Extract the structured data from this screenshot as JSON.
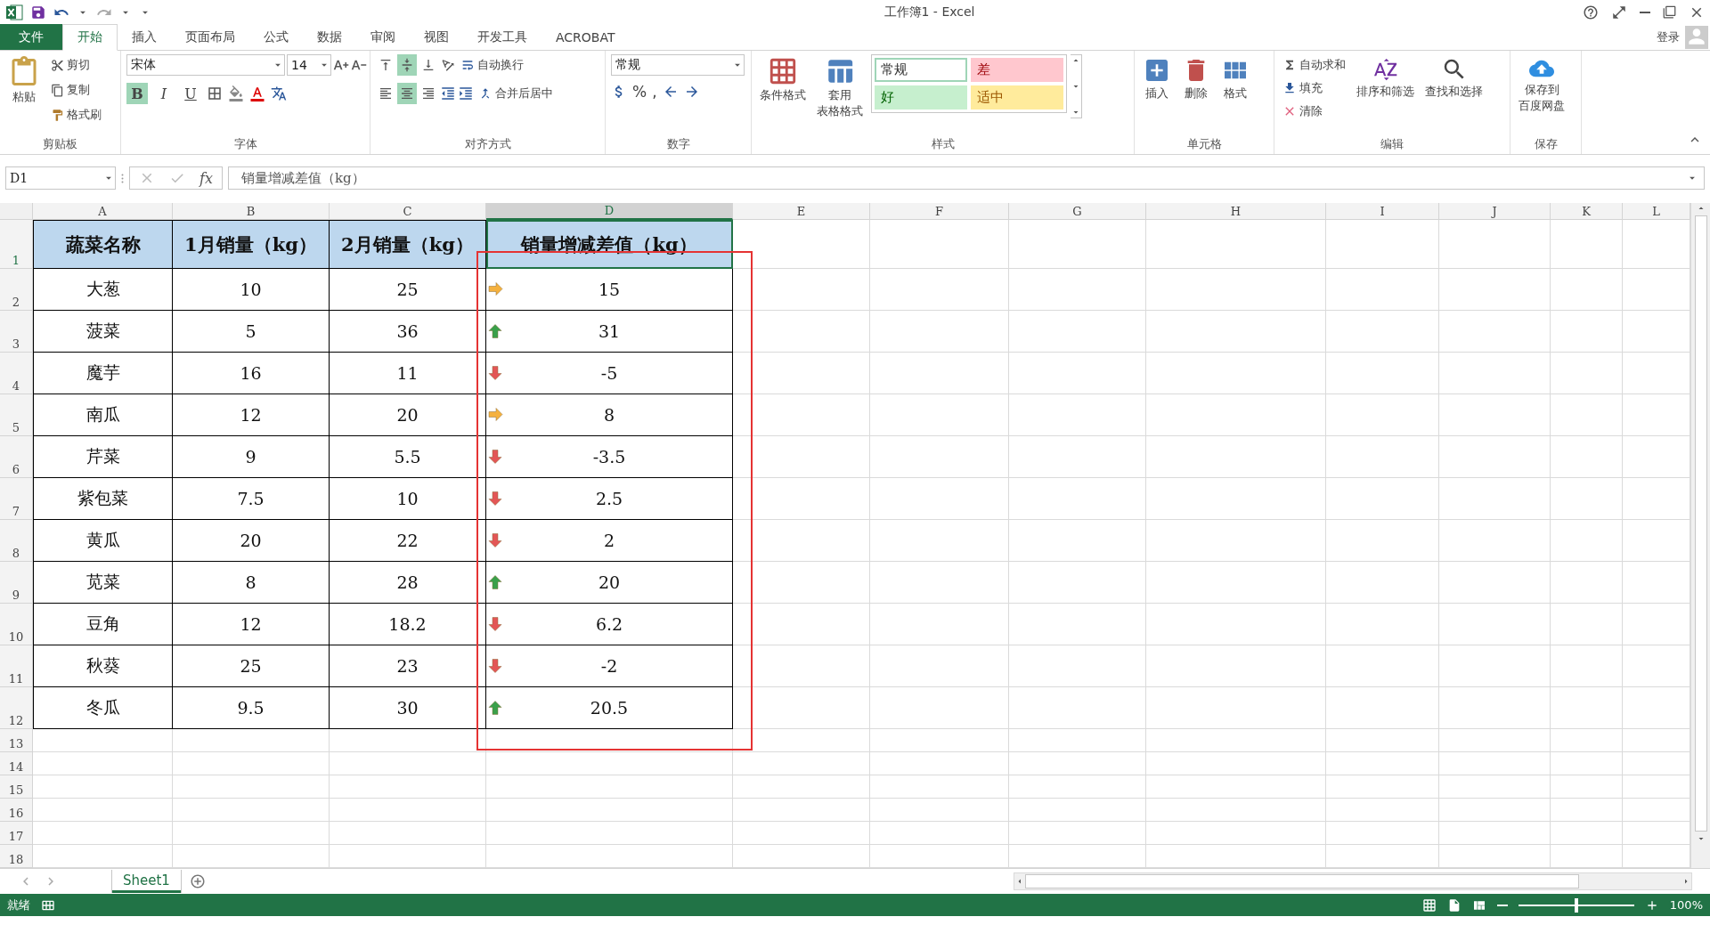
{
  "window": {
    "title": "工作簿1 - Excel",
    "user": "登录"
  },
  "menu_tabs": [
    {
      "label": "文件",
      "kind": "file",
      "selected": false
    },
    {
      "label": "开始",
      "kind": "tab",
      "selected": true
    },
    {
      "label": "插入",
      "kind": "tab",
      "selected": false
    },
    {
      "label": "页面布局",
      "kind": "tab",
      "selected": false
    },
    {
      "label": "公式",
      "kind": "tab",
      "selected": false
    },
    {
      "label": "数据",
      "kind": "tab",
      "selected": false
    },
    {
      "label": "审阅",
      "kind": "tab",
      "selected": false
    },
    {
      "label": "视图",
      "kind": "tab",
      "selected": false
    },
    {
      "label": "开发工具",
      "kind": "tab",
      "selected": false
    },
    {
      "label": "ACROBAT",
      "kind": "tab",
      "selected": false
    }
  ],
  "ribbon": {
    "clipboard": {
      "label": "剪贴板",
      "paste": "粘贴",
      "cut": "剪切",
      "copy": "复制",
      "painter": "格式刷"
    },
    "font": {
      "label": "字体",
      "name": "宋体",
      "size": "14",
      "bold": {
        "label": "B",
        "on": true
      },
      "italic": {
        "label": "I",
        "on": false
      },
      "underline": {
        "label": "U",
        "on": false
      }
    },
    "alignment": {
      "label": "对齐方式",
      "top": false,
      "middle": true,
      "bottom": false,
      "left": false,
      "center": true,
      "right": false,
      "wrap": "自动换行",
      "merge": "合并后居中"
    },
    "number": {
      "label": "数字",
      "format": "常规",
      "percent": "%",
      "comma": ","
    },
    "styles": {
      "label": "样式",
      "conditional": "条件格式",
      "table": [
        "套用",
        "表格格式"
      ],
      "cell_styles": [
        {
          "label": "常规",
          "color": "#ffffff",
          "selected": true
        },
        {
          "label": "差",
          "color": "#ffc7ce",
          "selected": false
        },
        {
          "label": "好",
          "color": "#c6efce",
          "selected": false
        },
        {
          "label": "适中",
          "color": "#ffeb9c",
          "selected": false
        }
      ]
    },
    "cells": {
      "label": "单元格",
      "insert": "插入",
      "delete": "删除",
      "format": "格式"
    },
    "editing": {
      "label": "编辑",
      "autosum": "自动求和",
      "fill": "填充",
      "clear": "清除",
      "sort": "排序和筛选",
      "find": "查找和选择"
    },
    "save": {
      "label": "保存",
      "button": [
        "保存到",
        "百度网盘"
      ]
    }
  },
  "formula_bar": {
    "name_box": "D1",
    "fx": "fx",
    "content": "销量增减差值（kg）"
  },
  "sheet": {
    "columns": [
      {
        "label": "A",
        "selected": false
      },
      {
        "label": "B",
        "selected": false
      },
      {
        "label": "C",
        "selected": false
      },
      {
        "label": "D",
        "selected": true
      },
      {
        "label": "E",
        "selected": false
      },
      {
        "label": "F",
        "selected": false
      },
      {
        "label": "G",
        "selected": false
      },
      {
        "label": "H",
        "selected": false
      },
      {
        "label": "I",
        "selected": false
      },
      {
        "label": "J",
        "selected": false
      },
      {
        "label": "K",
        "selected": false
      },
      {
        "label": "L",
        "selected": false
      }
    ],
    "row_numbers": [
      "1",
      "2",
      "3",
      "4",
      "5",
      "6",
      "7",
      "8",
      "9",
      "10",
      "11",
      "12",
      "13",
      "14",
      "15",
      "16",
      "17",
      "18"
    ],
    "header": [
      "蔬菜名称",
      "1月销量（kg）",
      "2月销量（kg）",
      "销量增减差值（kg）"
    ],
    "rows": [
      {
        "name": "大葱",
        "jan": "10",
        "feb": "25",
        "diff": "15",
        "kind": "flat"
      },
      {
        "name": "菠菜",
        "jan": "5",
        "feb": "36",
        "diff": "31",
        "kind": "up"
      },
      {
        "name": "魔芋",
        "jan": "16",
        "feb": "11",
        "diff": "-5",
        "kind": "down"
      },
      {
        "name": "南瓜",
        "jan": "12",
        "feb": "20",
        "diff": "8",
        "kind": "flat"
      },
      {
        "name": "芹菜",
        "jan": "9",
        "feb": "5.5",
        "diff": "-3.5",
        "kind": "down"
      },
      {
        "name": "紫包菜",
        "jan": "7.5",
        "feb": "10",
        "diff": "2.5",
        "kind": "down"
      },
      {
        "name": "黄瓜",
        "jan": "20",
        "feb": "22",
        "diff": "2",
        "kind": "down"
      },
      {
        "name": "苋菜",
        "jan": "8",
        "feb": "28",
        "diff": "20",
        "kind": "up"
      },
      {
        "name": "豆角",
        "jan": "12",
        "feb": "18.2",
        "diff": "6.2",
        "kind": "down"
      },
      {
        "name": "秋葵",
        "jan": "25",
        "feb": "23",
        "diff": "-2",
        "kind": "down"
      },
      {
        "name": "冬瓜",
        "jan": "9.5",
        "feb": "30",
        "diff": "20.5",
        "kind": "up"
      }
    ]
  },
  "sheet_tabs": [
    {
      "label": "Sheet1",
      "selected": true
    }
  ],
  "status_bar": {
    "ready": "就绪",
    "zoom": "100%",
    "zoom_slider": {
      "level": 0.5
    }
  }
}
